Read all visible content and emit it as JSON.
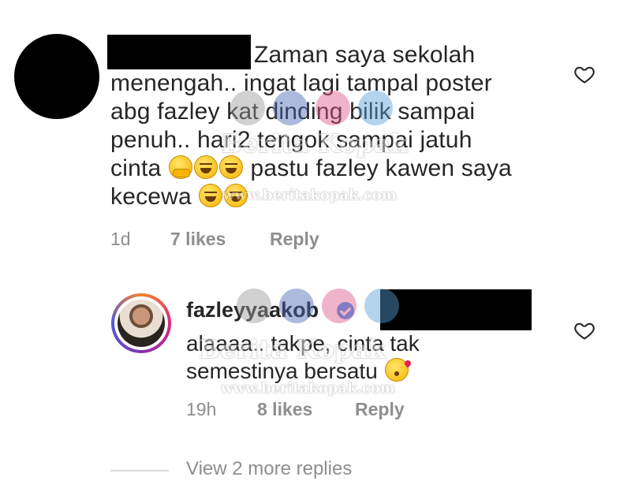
{
  "comments": [
    {
      "text": "Zaman saya sekolah menengah.. ingat lagi tampal poster abg fazley kat dinding bilik sampai penuh.. hari2 tengok sampai jatuh cinta",
      "text_tail_1": "pastu fazley kawen saya kecewa",
      "time": "1d",
      "likes": "7 likes",
      "reply_label": "Reply",
      "emojis": [
        "face-with-hand-over-mouth",
        "face-with-tears-of-joy",
        "face-with-tears-of-joy",
        "face-with-tears-of-joy",
        "face-with-tears-of-joy"
      ]
    }
  ],
  "reply": {
    "username": "fazleyyaakob",
    "verified": true,
    "text": "alaaaa.. takpe, cinta tak semestinya bersatu",
    "emoji": "face-blowing-a-kiss",
    "time": "19h",
    "likes": "8 likes",
    "reply_label": "Reply"
  },
  "view_more": "View 2 more replies",
  "watermark": {
    "brand": "Berita Kopak",
    "url": "www.beritakopak.com"
  },
  "colors": {
    "text": "#262626",
    "meta": "#8e8e8e",
    "verified": "#3897f0"
  }
}
